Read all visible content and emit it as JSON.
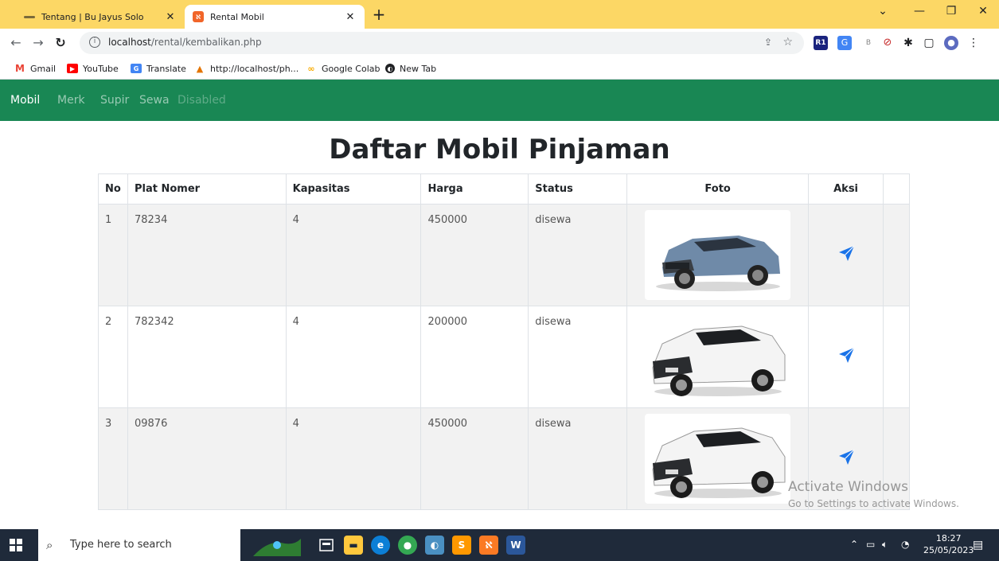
{
  "browser": {
    "tabs": [
      {
        "title": "Tentang | Bu Jayus Solo",
        "active": false
      },
      {
        "title": "Rental Mobil",
        "active": true
      }
    ],
    "address": {
      "host": "localhost",
      "path": "/rental/kembalikan.php"
    },
    "bookmarks": [
      "Gmail",
      "YouTube",
      "Translate",
      "http://localhost/ph...",
      "Google Colab",
      "New Tab"
    ],
    "extension_labels": [
      "R1",
      "B"
    ]
  },
  "app": {
    "nav": [
      {
        "label": "Mobil",
        "state": "active"
      },
      {
        "label": "Merk",
        "state": "normal"
      },
      {
        "label": "Supir",
        "state": "normal"
      },
      {
        "label": "Sewa",
        "state": "normal"
      },
      {
        "label": "Disabled",
        "state": "disabled"
      }
    ],
    "nav_color": "#198754",
    "heading": "Daftar Mobil Pinjaman",
    "table": {
      "headers": [
        "No",
        "Plat Nomer",
        "Kapasitas",
        "Harga",
        "Status",
        "Foto",
        "Aksi"
      ],
      "rows": [
        {
          "no": "1",
          "plat": "78234",
          "kapasitas": "4",
          "harga": "450000",
          "status": "disewa",
          "foto": "blue-suv",
          "aksi_icon": "send-icon"
        },
        {
          "no": "2",
          "plat": "782342",
          "kapasitas": "4",
          "harga": "200000",
          "status": "disewa",
          "foto": "white-suv",
          "aksi_icon": "send-icon"
        },
        {
          "no": "3",
          "plat": "09876",
          "kapasitas": "4",
          "harga": "450000",
          "status": "disewa",
          "foto": "white-suv",
          "aksi_icon": "send-icon"
        }
      ]
    }
  },
  "watermark": {
    "line1": "Activate Windows",
    "line2": "Go to Settings to activate Windows."
  },
  "taskbar": {
    "search_placeholder": "Type here to search",
    "time": "18:27",
    "date": "25/05/2023",
    "word_label": "W"
  }
}
